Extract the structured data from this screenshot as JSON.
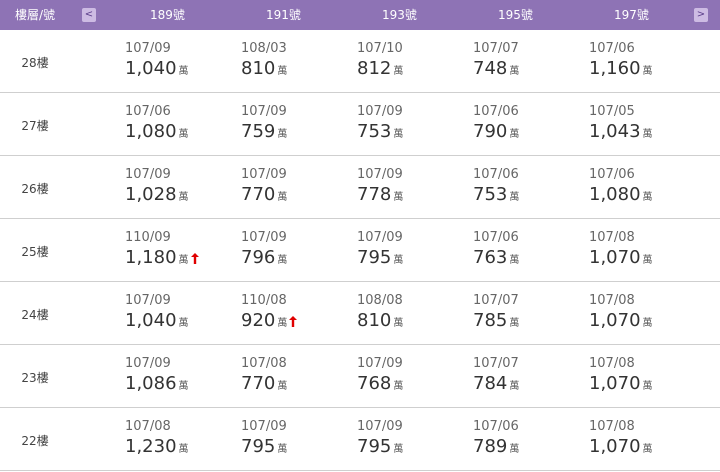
{
  "header": {
    "floor_label": "樓層/號",
    "prev_label": "<",
    "next_label": ">",
    "columns": [
      "189號",
      "191號",
      "193號",
      "195號",
      "197號"
    ]
  },
  "colors": {
    "header_bg": "#8e73b5",
    "rise_arrow": "#e00000"
  },
  "unit": "萬",
  "rows": [
    {
      "floor": "28樓",
      "cells": [
        {
          "date": "107/09",
          "price": "1,040",
          "rise": false
        },
        {
          "date": "108/03",
          "price": "810",
          "rise": false
        },
        {
          "date": "107/10",
          "price": "812",
          "rise": false
        },
        {
          "date": "107/07",
          "price": "748",
          "rise": false
        },
        {
          "date": "107/06",
          "price": "1,160",
          "rise": false
        }
      ]
    },
    {
      "floor": "27樓",
      "cells": [
        {
          "date": "107/06",
          "price": "1,080",
          "rise": false
        },
        {
          "date": "107/09",
          "price": "759",
          "rise": false
        },
        {
          "date": "107/09",
          "price": "753",
          "rise": false
        },
        {
          "date": "107/06",
          "price": "790",
          "rise": false
        },
        {
          "date": "107/05",
          "price": "1,043",
          "rise": false
        }
      ]
    },
    {
      "floor": "26樓",
      "cells": [
        {
          "date": "107/09",
          "price": "1,028",
          "rise": false
        },
        {
          "date": "107/09",
          "price": "770",
          "rise": false
        },
        {
          "date": "107/09",
          "price": "778",
          "rise": false
        },
        {
          "date": "107/06",
          "price": "753",
          "rise": false
        },
        {
          "date": "107/06",
          "price": "1,080",
          "rise": false
        }
      ]
    },
    {
      "floor": "25樓",
      "cells": [
        {
          "date": "110/09",
          "price": "1,180",
          "rise": true
        },
        {
          "date": "107/09",
          "price": "796",
          "rise": false
        },
        {
          "date": "107/09",
          "price": "795",
          "rise": false
        },
        {
          "date": "107/06",
          "price": "763",
          "rise": false
        },
        {
          "date": "107/08",
          "price": "1,070",
          "rise": false
        }
      ]
    },
    {
      "floor": "24樓",
      "cells": [
        {
          "date": "107/09",
          "price": "1,040",
          "rise": false
        },
        {
          "date": "110/08",
          "price": "920",
          "rise": true
        },
        {
          "date": "108/08",
          "price": "810",
          "rise": false
        },
        {
          "date": "107/07",
          "price": "785",
          "rise": false
        },
        {
          "date": "107/08",
          "price": "1,070",
          "rise": false
        }
      ]
    },
    {
      "floor": "23樓",
      "cells": [
        {
          "date": "107/09",
          "price": "1,086",
          "rise": false
        },
        {
          "date": "107/08",
          "price": "770",
          "rise": false
        },
        {
          "date": "107/09",
          "price": "768",
          "rise": false
        },
        {
          "date": "107/07",
          "price": "784",
          "rise": false
        },
        {
          "date": "107/08",
          "price": "1,070",
          "rise": false
        }
      ]
    },
    {
      "floor": "22樓",
      "cells": [
        {
          "date": "107/08",
          "price": "1,230",
          "rise": false
        },
        {
          "date": "107/09",
          "price": "795",
          "rise": false
        },
        {
          "date": "107/09",
          "price": "795",
          "rise": false
        },
        {
          "date": "107/06",
          "price": "789",
          "rise": false
        },
        {
          "date": "107/08",
          "price": "1,070",
          "rise": false
        }
      ]
    }
  ]
}
